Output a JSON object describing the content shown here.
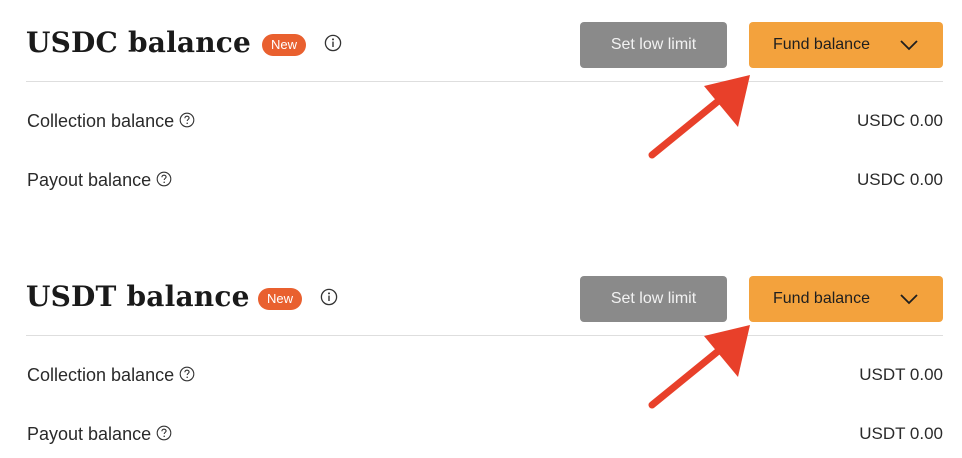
{
  "colors": {
    "badge": "#e9602f",
    "limit_button": "#8a8a8a",
    "fund_button": "#f3a23d",
    "arrow": "#e8402a"
  },
  "usdc": {
    "title": "USDC balance",
    "badge": "New",
    "set_low_limit": "Set low limit",
    "fund_balance": "Fund balance",
    "collection_label": "Collection balance",
    "collection_value": "USDC 0.00",
    "payout_label": "Payout balance",
    "payout_value": "USDC 0.00"
  },
  "usdt": {
    "title": "USDT balance",
    "badge": "New",
    "set_low_limit": "Set low limit",
    "fund_balance": "Fund balance",
    "collection_label": "Collection balance",
    "collection_value": "USDT 0.00",
    "payout_label": "Payout balance",
    "payout_value": "USDT 0.00"
  },
  "icons": {
    "info": "info-circle-icon",
    "help": "question-circle-icon",
    "dropdown": "chevron-down-icon",
    "annotation": "red-arrow-annotation"
  }
}
